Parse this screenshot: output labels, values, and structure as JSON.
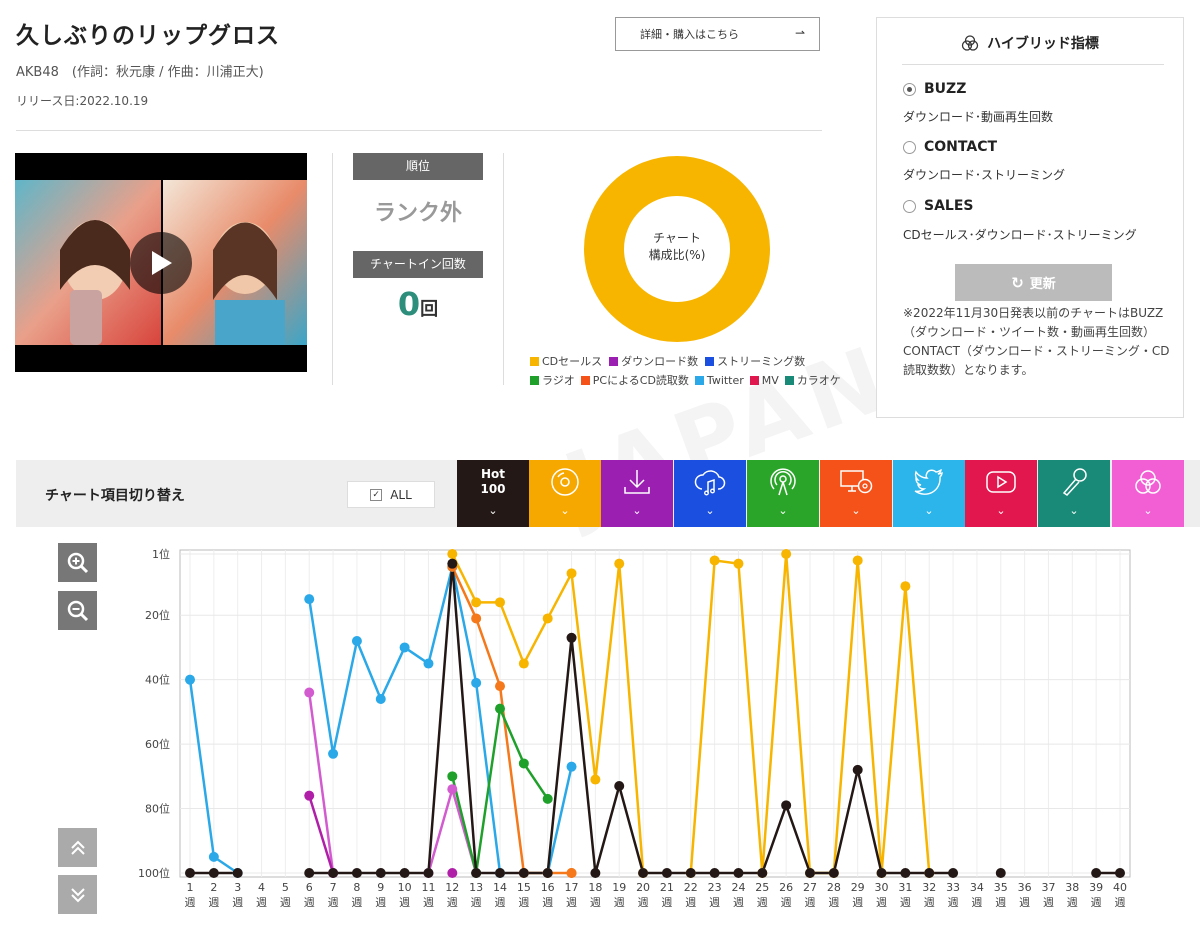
{
  "song": {
    "title": "久しぶりのリップグロス",
    "artist_line": "AKB48　(作詞：秋元康 / 作曲：川浦正大)",
    "release": "リリース日:2022.10.19",
    "buy_label": "詳細・購入はこちら"
  },
  "stats": {
    "rank_label": "順位",
    "rank_value": "ランク外",
    "chartin_label": "チャートイン回数",
    "chartin_count": "0",
    "chartin_unit": "回"
  },
  "donut": {
    "center_line1": "チャート",
    "center_line2": "構成比(%)",
    "color": "#f7b500",
    "legend": [
      {
        "label": "CDセールス",
        "color": "#f7b500"
      },
      {
        "label": "ダウンロード数",
        "color": "#9b1fb0"
      },
      {
        "label": "ストリーミング数",
        "color": "#1b4fe0"
      },
      {
        "label": "ラジオ",
        "color": "#1fa02a"
      },
      {
        "label": "PCによるCD読取数",
        "color": "#f5521a"
      },
      {
        "label": "Twitter",
        "color": "#2aa8e8"
      },
      {
        "label": "MV",
        "color": "#e0174f"
      },
      {
        "label": "カラオケ",
        "color": "#1a8a78"
      }
    ]
  },
  "hybrid": {
    "title": "ハイブリッド指標",
    "options": [
      {
        "name": "BUZZ",
        "desc": "ダウンロード･動画再生回数",
        "selected": true
      },
      {
        "name": "CONTACT",
        "desc": "ダウンロード･ストリーミング",
        "selected": false
      },
      {
        "name": "SALES",
        "desc": "CDセールス･ダウンロード･ストリーミング",
        "selected": false
      }
    ],
    "update_label": "更新",
    "note": "※2022年11月30日発表以前のチャートはBUZZ（ダウンロード・ツイート数・動画再生回数）CONTACT（ダウンロード・ストリーミング・CD読取数数）となります。"
  },
  "switcher": {
    "label": "チャート項目切り替え",
    "all_label": "ALL",
    "hot_line1": "Hot",
    "hot_line2": "100",
    "categories": [
      {
        "icon": "hot100-icon",
        "color": "#231815"
      },
      {
        "icon": "cd-icon",
        "color": "#f7a800"
      },
      {
        "icon": "download-icon",
        "color": "#9b1fb0"
      },
      {
        "icon": "streaming-icon",
        "color": "#1b4fe0"
      },
      {
        "icon": "radio-icon",
        "color": "#2aa52a"
      },
      {
        "icon": "pc-cd-icon",
        "color": "#f5521a"
      },
      {
        "icon": "twitter-icon",
        "color": "#2bb5ea"
      },
      {
        "icon": "youtube-icon",
        "color": "#e2174e"
      },
      {
        "icon": "karaoke-icon",
        "color": "#1a8a78"
      },
      {
        "icon": "hybrid-icon",
        "color": "#f25fd4"
      }
    ]
  },
  "chart_data": {
    "type": "line",
    "y_inverted": true,
    "ylim": [
      1,
      100
    ],
    "y_ticks": [
      "1位",
      "20位",
      "40位",
      "60位",
      "80位",
      "100位"
    ],
    "y_tick_values": [
      1,
      20,
      40,
      60,
      80,
      100
    ],
    "x_label_suffix": "週",
    "x": [
      1,
      2,
      3,
      4,
      5,
      6,
      7,
      8,
      9,
      10,
      11,
      12,
      13,
      14,
      15,
      16,
      17,
      18,
      19,
      20,
      21,
      22,
      23,
      24,
      25,
      26,
      27,
      28,
      29,
      30,
      31,
      32,
      33,
      34,
      35,
      36,
      37,
      38,
      39,
      40
    ],
    "series": [
      {
        "color": "#2aa8e8",
        "points": [
          [
            1,
            40
          ],
          [
            2,
            95
          ],
          [
            3,
            100
          ],
          [
            6,
            15
          ],
          [
            7,
            63
          ],
          [
            8,
            28
          ],
          [
            9,
            46
          ],
          [
            10,
            30
          ],
          [
            11,
            35
          ],
          [
            12,
            5
          ],
          [
            13,
            41
          ],
          [
            14,
            100
          ],
          [
            16,
            100
          ],
          [
            17,
            67
          ]
        ]
      },
      {
        "color": "#d35bd0",
        "points": [
          [
            6,
            44
          ],
          [
            7,
            100
          ],
          [
            11,
            100
          ],
          [
            12,
            74
          ],
          [
            13,
            100
          ]
        ]
      },
      {
        "color": "#b01fa8",
        "points": [
          [
            6,
            76
          ],
          [
            7,
            100
          ]
        ]
      },
      {
        "color": "#f7b500",
        "points": [
          [
            12,
            1
          ],
          [
            13,
            16
          ],
          [
            14,
            16
          ],
          [
            15,
            35
          ],
          [
            16,
            21
          ],
          [
            17,
            7
          ],
          [
            18,
            71
          ],
          [
            19,
            4
          ],
          [
            20,
            100
          ],
          [
            22,
            100
          ],
          [
            23,
            3
          ],
          [
            24,
            4
          ],
          [
            25,
            100
          ],
          [
            26,
            1
          ],
          [
            27,
            100
          ],
          [
            28,
            100
          ],
          [
            29,
            3
          ],
          [
            30,
            100
          ],
          [
            31,
            11
          ],
          [
            32,
            100
          ]
        ]
      },
      {
        "color": "#f5781a",
        "points": [
          [
            12,
            5
          ],
          [
            13,
            21
          ],
          [
            14,
            42
          ],
          [
            15,
            100
          ],
          [
            16,
            100
          ],
          [
            17,
            100
          ]
        ]
      },
      {
        "color": "#1fa02a",
        "points": [
          [
            12,
            70
          ],
          [
            13,
            100
          ],
          [
            14,
            49
          ],
          [
            15,
            66
          ],
          [
            16,
            77
          ]
        ]
      },
      {
        "color": "#231815",
        "points": [
          [
            1,
            100
          ],
          [
            2,
            100
          ],
          [
            3,
            100
          ],
          [
            6,
            100
          ],
          [
            7,
            100
          ],
          [
            8,
            100
          ],
          [
            9,
            100
          ],
          [
            10,
            100
          ],
          [
            11,
            100
          ],
          [
            12,
            4
          ],
          [
            13,
            100
          ],
          [
            14,
            100
          ],
          [
            15,
            100
          ],
          [
            16,
            100
          ],
          [
            17,
            27
          ],
          [
            18,
            100
          ],
          [
            19,
            73
          ],
          [
            20,
            100
          ],
          [
            21,
            100
          ],
          [
            22,
            100
          ],
          [
            23,
            100
          ],
          [
            24,
            100
          ],
          [
            25,
            100
          ],
          [
            26,
            79
          ],
          [
            27,
            100
          ],
          [
            28,
            100
          ],
          [
            29,
            68
          ],
          [
            30,
            100
          ],
          [
            31,
            100
          ],
          [
            32,
            100
          ],
          [
            33,
            100
          ],
          [
            35,
            100
          ],
          [
            39,
            100
          ],
          [
            40,
            100
          ]
        ]
      }
    ],
    "extra_points": [
      {
        "x": 12,
        "y": 100,
        "color": "#b01fa8"
      },
      {
        "x": 17,
        "y": 100,
        "color": "#f5781a"
      }
    ]
  }
}
